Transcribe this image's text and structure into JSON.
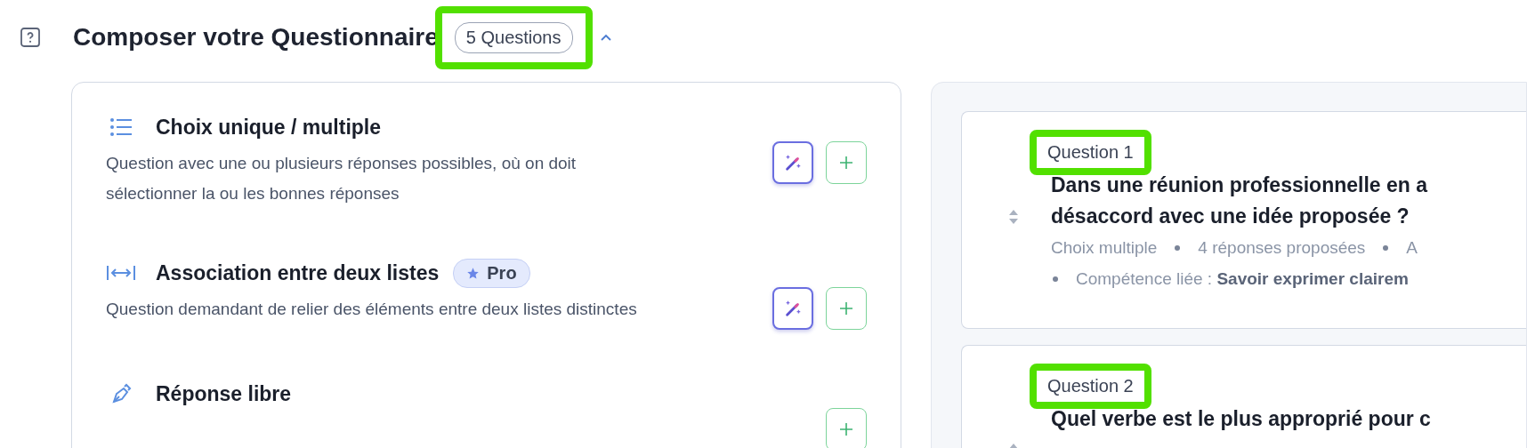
{
  "header": {
    "title": "Composer votre Questionnaire",
    "badge": {
      "label": "5 Questions",
      "highlighted": true
    },
    "expanded": true
  },
  "question_types": [
    {
      "kind": "choice",
      "title": "Choix unique / multiple",
      "description": "Question avec une ou plusieurs réponses possibles, où on doit sélectionner la ou les bonnes réponses",
      "ai": true
    },
    {
      "kind": "matching",
      "title": "Association entre deux listes",
      "badge": "Pro",
      "description": "Question demandant de relier des éléments entre deux listes distinctes",
      "ai": true
    },
    {
      "kind": "free_text",
      "title": "Réponse libre",
      "ai": false
    }
  ],
  "questions": [
    {
      "label": "Question 1",
      "highlighted": true,
      "text": "Dans une réunion professionnelle en a",
      "text_2": "désaccord avec une idée proposée ?",
      "meta": [
        "Choix multiple",
        "4 réponses proposées",
        "A"
      ],
      "competence": "Compétence liée : **Savoir exprimer clairem**"
    },
    {
      "label": "Question 2",
      "highlighted": true,
      "text": "Quel verbe est le plus approprié pour c"
    }
  ]
}
